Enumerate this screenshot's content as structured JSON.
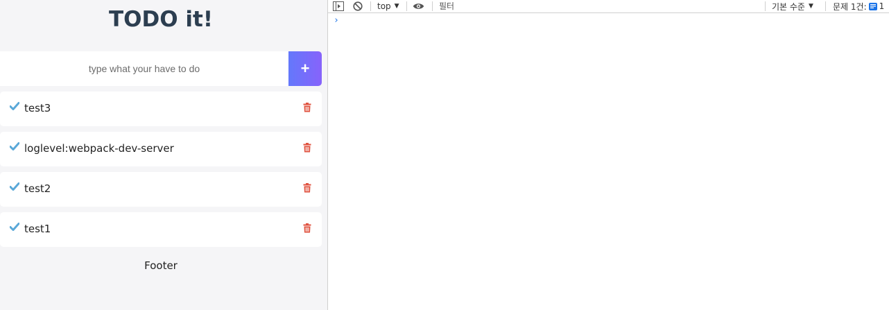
{
  "app": {
    "title": "TODO it!",
    "input_placeholder": "type what your have to do",
    "add_button": "+",
    "items": [
      {
        "text": "test3"
      },
      {
        "text": "loglevel:webpack-dev-server"
      },
      {
        "text": "test2"
      },
      {
        "text": "test1"
      }
    ],
    "footer": "Footer"
  },
  "devtools": {
    "context": "top",
    "filter_placeholder": "필터",
    "levels_label": "기본 수준",
    "issues_label": "문제 1건:",
    "issues_count": "1",
    "prompt_symbol": "›"
  },
  "colors": {
    "title": "#2c3e50",
    "add_gradient_start": "#6478fb",
    "add_gradient_end": "#8763fb",
    "check": "#5aa8d8",
    "trash": "#e0523f",
    "app_bg": "#f5f5f7"
  }
}
